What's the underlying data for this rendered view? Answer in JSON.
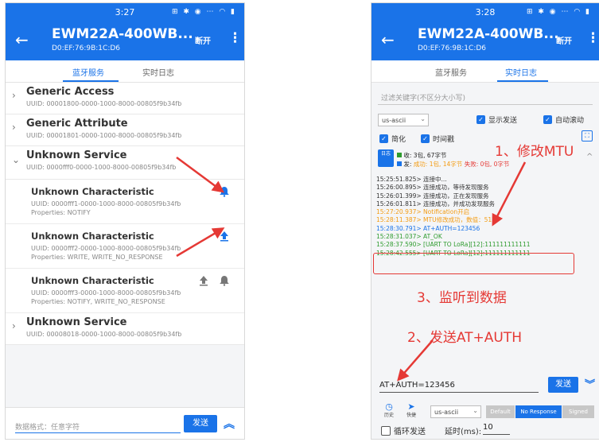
{
  "left": {
    "time": "3:27",
    "status_icons": "⊞ ✱ ◉ ⋯ ◠ ▮",
    "device_name": "EWM22A-400WB...",
    "device_mac": "D0:EF:76:9B:1C:D6",
    "disconnect": "断开",
    "tabs": [
      "蓝牙服务",
      "实时日志"
    ],
    "services": [
      {
        "name": "Generic Access",
        "uuid": "UUID: 00001800-0000-1000-8000-00805f9b34fb"
      },
      {
        "name": "Generic Attribute",
        "uuid": "UUID: 00001801-0000-1000-8000-00805f9b34fb"
      },
      {
        "name": "Unknown Service",
        "uuid": "UUID: 0000fff0-0000-1000-8000-00805f9b34fb"
      },
      {
        "name": "Unknown Service",
        "uuid": "UUID: 00008018-0000-1000-8000-00805f9b34fb"
      }
    ],
    "characteristics": [
      {
        "name": "Unknown Characteristic",
        "uuid": "UUID: 0000fff1-0000-1000-8000-00805f9b34fb",
        "props": "Properties: NOTIFY"
      },
      {
        "name": "Unknown Characteristic",
        "uuid": "UUID: 0000fff2-0000-1000-8000-00805f9b34fb",
        "props": "Properties: WRITE, WRITE_NO_RESPONSE"
      },
      {
        "name": "Unknown Characteristic",
        "uuid": "UUID: 0000fff3-0000-1000-8000-00805f9b34fb",
        "props": "Properties: NOTIFY, WRITE_NO_RESPONSE"
      }
    ],
    "input_placeholder": "数据格式：任意字符",
    "send": "发送"
  },
  "right": {
    "time": "3:28",
    "status_icons": "⊞ ✱ ◉ ⋯ ◠ ▮",
    "device_name": "EWM22A-400WB...",
    "device_mac": "D0:EF:76:9B:1C:D6",
    "disconnect": "断开",
    "tabs": [
      "蓝牙服务",
      "实时日志"
    ],
    "filter_placeholder": "过滤关键字(不区分大小写)",
    "encoding": "us-ascii",
    "show_send": "显示发送",
    "auto_scroll": "自动滚动",
    "simple": "简化",
    "timestamp": "时间戳",
    "clear": "日志",
    "recv_stat": "收: 3包, 67字节",
    "send_stat_prefix": "发: ",
    "send_stat_ok": "成功: 1包, 14字节",
    "send_stat_fail": " 失败: 0包, 0字节",
    "logs": [
      {
        "text": "15:25:51.825> 连接中...",
        "color": "#333333"
      },
      {
        "text": "15:26:00.895> 连接成功，等待发现服务",
        "color": "#333333"
      },
      {
        "text": "15:26:01.399> 连接成功，正在发现服务",
        "color": "#333333"
      },
      {
        "text": "15:26:01.811> 连接成功，并成功发现服务",
        "color": "#333333"
      },
      {
        "text": "15:27:20.937> Notification开启",
        "color": "#f39c12"
      },
      {
        "text": "15:28:11.387> MTU修改成功，数值：517",
        "color": "#f39c12"
      },
      {
        "text": "15:28:30.791> AT+AUTH=123456",
        "color": "#1a73e8"
      },
      {
        "text": "15:28:31.037> AT_OK",
        "color": "#2e9b2e"
      },
      {
        "text": "15:28:37.590> [UART TO LoRa][12]:111111111111",
        "color": "#2e9b2e"
      },
      {
        "text": "15:28:42.555> [UART TO LoRa][12]:111111111111",
        "color": "#2e9b2e"
      }
    ],
    "send_value": "AT+AUTH=123456",
    "send": "发送",
    "history": "历史",
    "quick": "快捷",
    "modes": [
      "Default",
      "No Response",
      "Signed"
    ],
    "loop_send": "循环发送",
    "delay_label": "延时(ms):",
    "delay_value": "10"
  },
  "annotations": {
    "a1": "1、修改MTU",
    "a2": "2、发送AT+AUTH",
    "a3": "3、监听到数据"
  },
  "colors": {
    "accent": "#1a73e8",
    "annotation": "#e53935"
  }
}
